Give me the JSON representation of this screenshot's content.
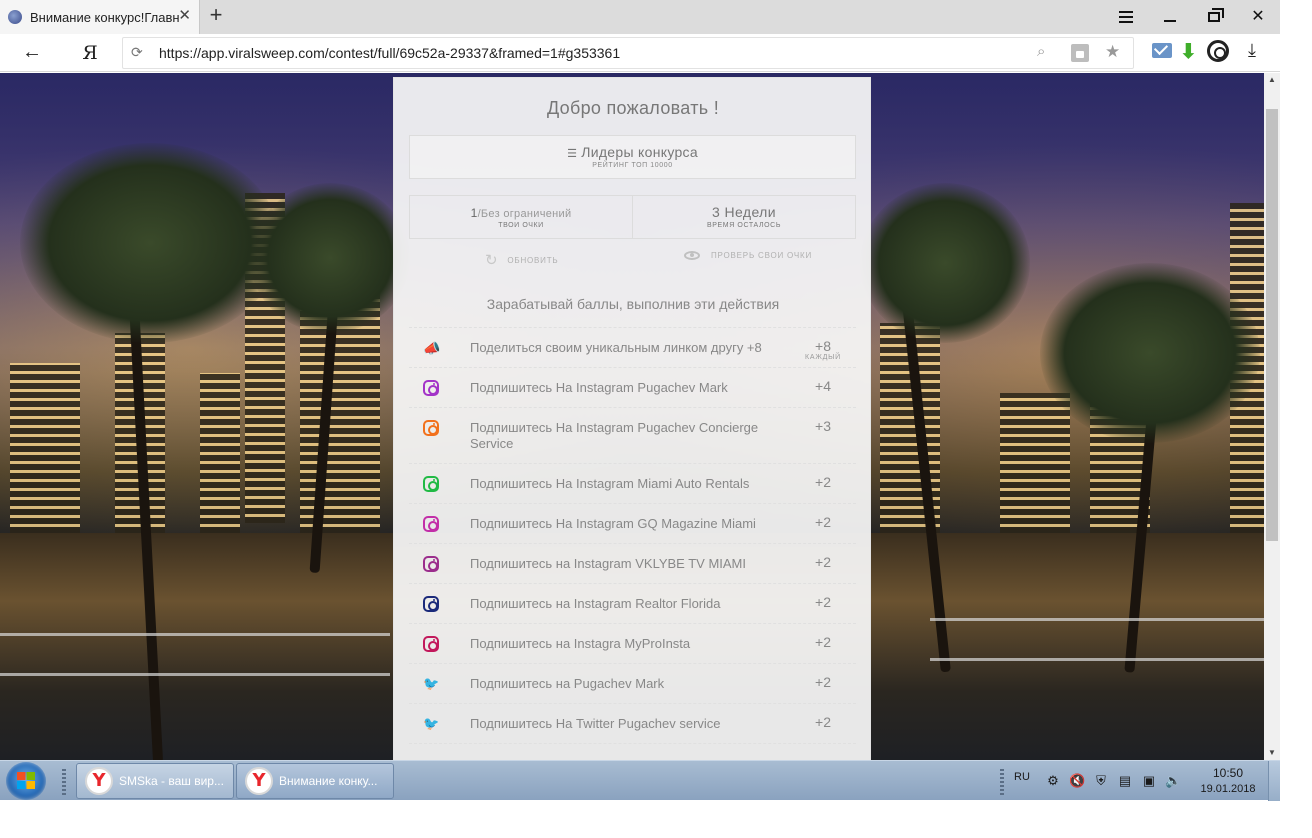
{
  "browser": {
    "tab": {
      "title": "Внимание конкурс!Главн",
      "close": "✕"
    },
    "new_tab": "+",
    "window_controls": {
      "menu": "menu-icon",
      "minimize": "minimize-icon",
      "restore": "restore-icon",
      "close": "✕"
    },
    "back": "←",
    "yandex_button": "Я",
    "url": "https://app.viralsweep.com/contest/full/69c52a-29337&framed=1#g353361",
    "icons": [
      "reload-icon",
      "search-icon",
      "lock-icon",
      "star-icon",
      "mail-icon",
      "download-arrow-icon",
      "sync-icon",
      "downloads-icon"
    ]
  },
  "contest": {
    "welcome": "Добро пожаловать !",
    "leaders": {
      "label": "Лидеры конкурса",
      "sub": "РЕЙТИНГ ТОП 10000"
    },
    "stats": {
      "points": {
        "value": "1",
        "suffix": "/Без ограничений",
        "label": "ТВОИ ОЧКИ"
      },
      "time": {
        "value": "3 Недели",
        "label": "ВРЕМЯ ОСТАЛОСЬ"
      }
    },
    "refresh_label": "ОБНОВИТЬ",
    "check_label": "ПРОВЕРЬ СВОИ ОЧКИ",
    "earn_title": "Зарабатывай баллы, выполнив эти действия",
    "tasks": [
      {
        "icon": "megaphone-icon",
        "color": "#e0245e",
        "label": "Поделиться своим уникальным линком другу +8",
        "points": "+8",
        "points_sub": "КАЖДЫЙ"
      },
      {
        "icon": "instagram-icon",
        "color": "#a333c8",
        "label": "Подпишитесь На Instagram Pugachev Mark",
        "points": "+4"
      },
      {
        "icon": "instagram-icon",
        "color": "#f2711c",
        "label": "Подпишитесь На Instagram Pugachev Concierge Service",
        "points": "+3"
      },
      {
        "icon": "instagram-icon",
        "color": "#21ba45",
        "label": "Подпишитесь На Instagram Miami Auto Rentals",
        "points": "+2"
      },
      {
        "icon": "instagram-icon",
        "color": "#c22ea8",
        "label": "Подпишитесь На Instagram GQ Magazine Miami",
        "points": "+2"
      },
      {
        "icon": "instagram-icon",
        "color": "#9b2d8c",
        "label": "Подпишитесь на Instagram VKLYBE TV MIAMI",
        "points": "+2"
      },
      {
        "icon": "instagram-icon",
        "color": "#1b2a7a",
        "label": "Подпишитесь на Instagram Realtor Florida",
        "points": "+2"
      },
      {
        "icon": "instagram-icon",
        "color": "#c2185b",
        "label": "Подпишитесь на Instagra MyProInsta",
        "points": "+2"
      },
      {
        "icon": "twitter-icon",
        "color": "#1b2a7a",
        "label": "Подпишитесь на Pugachev Mark",
        "points": "+2"
      },
      {
        "icon": "twitter-icon",
        "color": "#1da1f2",
        "label": "Подпишитесь На Twitter Pugachev service",
        "points": "+2"
      }
    ]
  },
  "taskbar": {
    "start": "start-icon",
    "buttons": [
      {
        "label": "SMSka - ваш вир...",
        "icon": "yandex-icon"
      },
      {
        "label": "Внимание конку...",
        "icon": "yandex-icon"
      }
    ],
    "lang": "RU",
    "tray_icons": [
      "network-status-icon",
      "speaker-muted-icon",
      "shield-icon",
      "clipboard-icon",
      "network-icon",
      "volume-icon"
    ],
    "time": "10:50",
    "date": "19.01.2018"
  }
}
